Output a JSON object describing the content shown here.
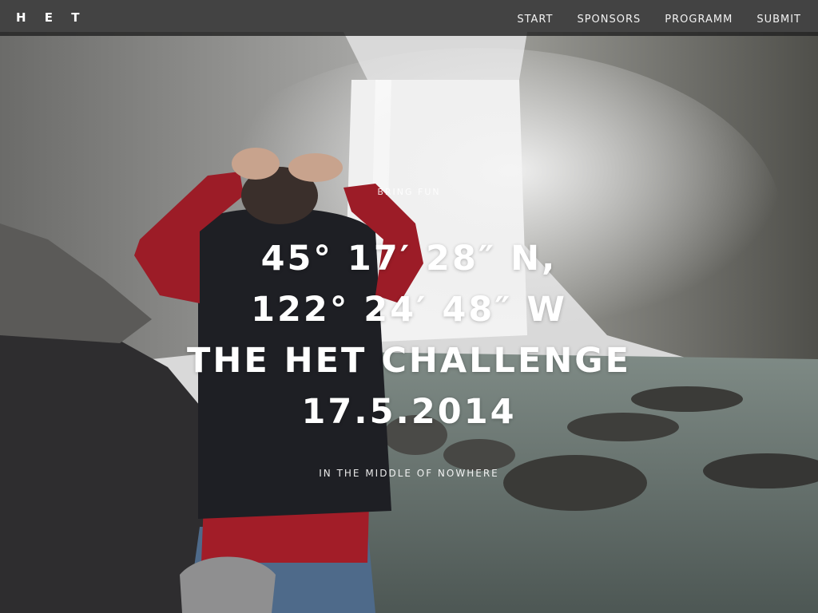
{
  "navbar": {
    "brand": "H E T",
    "items": [
      {
        "label": "START"
      },
      {
        "label": "SPONSORS"
      },
      {
        "label": "PROGRAMM"
      },
      {
        "label": "SUBMIT"
      }
    ]
  },
  "hero": {
    "tagline": "BRING FUN",
    "headline": [
      "45° 17′ 28″ N,",
      "122° 24′ 48″ W",
      "THE HET CHALLENGE",
      "17.5.2014"
    ],
    "subline": "IN THE MIDDLE OF NOWHERE"
  },
  "colors": {
    "navbar_bg": "#222222",
    "text": "#ffffff"
  }
}
